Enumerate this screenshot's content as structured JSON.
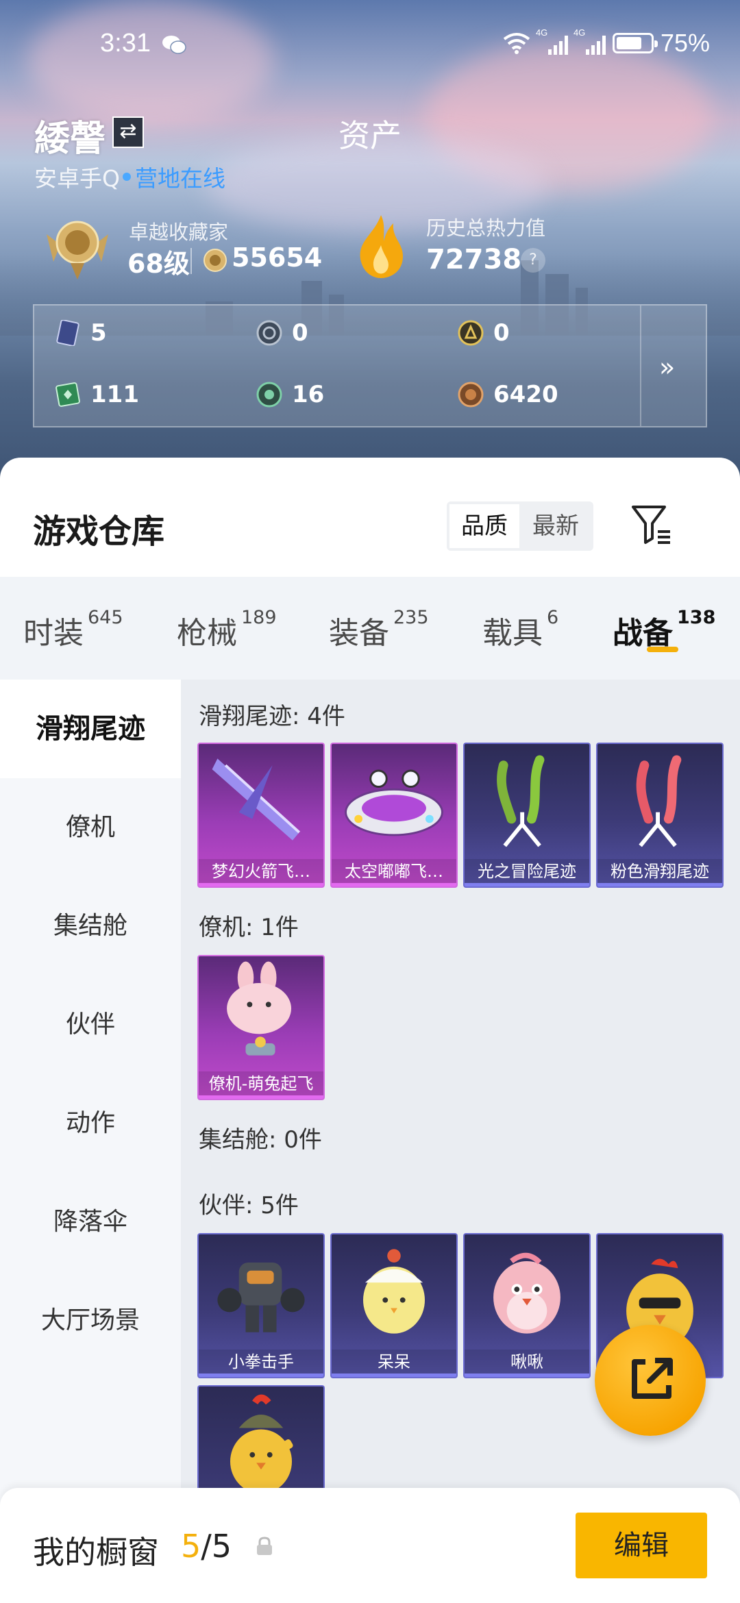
{
  "status_bar": {
    "time": "3:31",
    "battery": "75%",
    "network_1": "4G",
    "network_2": "4G"
  },
  "profile": {
    "username": "緌謦",
    "assets_title": "资产",
    "platform": "安卓手Q",
    "online_status": "营地在线",
    "rank_title": "卓越收藏家",
    "rank_level": "68级",
    "coin_value": "55654",
    "heat_title": "历史总热力值",
    "heat_value": "72738",
    "help": "?"
  },
  "resources": [
    {
      "icon": "card-icon",
      "value": "5"
    },
    {
      "icon": "silver-coin-icon",
      "value": "0"
    },
    {
      "icon": "gold-token-icon",
      "value": "0"
    },
    {
      "icon": "green-ticket-icon",
      "value": "111"
    },
    {
      "icon": "green-coin-icon",
      "value": "16"
    },
    {
      "icon": "bronze-coin-icon",
      "value": "6420"
    }
  ],
  "resources_more": "»",
  "warehouse": {
    "title": "游戏仓库",
    "sort_options": [
      "品质",
      "最新"
    ],
    "tabs": [
      {
        "label": "时装",
        "count": "645"
      },
      {
        "label": "枪械",
        "count": "189"
      },
      {
        "label": "装备",
        "count": "235"
      },
      {
        "label": "载具",
        "count": "6"
      },
      {
        "label": "战备",
        "count": "138"
      }
    ],
    "sidebar": [
      "滑翔尾迹",
      "僚机",
      "集结舱",
      "伙伴",
      "动作",
      "降落伞",
      "大厅场景"
    ],
    "sections": [
      {
        "title": "滑翔尾迹: 4件",
        "items": [
          "梦幻火箭飞…",
          "太空嘟嘟飞…",
          "光之冒险尾迹",
          "粉色滑翔尾迹"
        ]
      },
      {
        "title": "僚机: 1件",
        "items": [
          "僚机-萌兔起飞"
        ]
      },
      {
        "title": "集结舱: 0件",
        "items": []
      },
      {
        "title": "伙伴: 5件",
        "items": [
          "小拳击手",
          "呆呆",
          "啾啾"
        ]
      }
    ]
  },
  "showcase": {
    "label": "我的橱窗",
    "current": "5",
    "separator": "/",
    "total": "5",
    "edit_label": "编辑"
  },
  "colors": {
    "accent": "#f4b00c",
    "online": "#3b9cff",
    "purple_quality": "#c24bcc",
    "blue_quality": "#5553a6"
  }
}
